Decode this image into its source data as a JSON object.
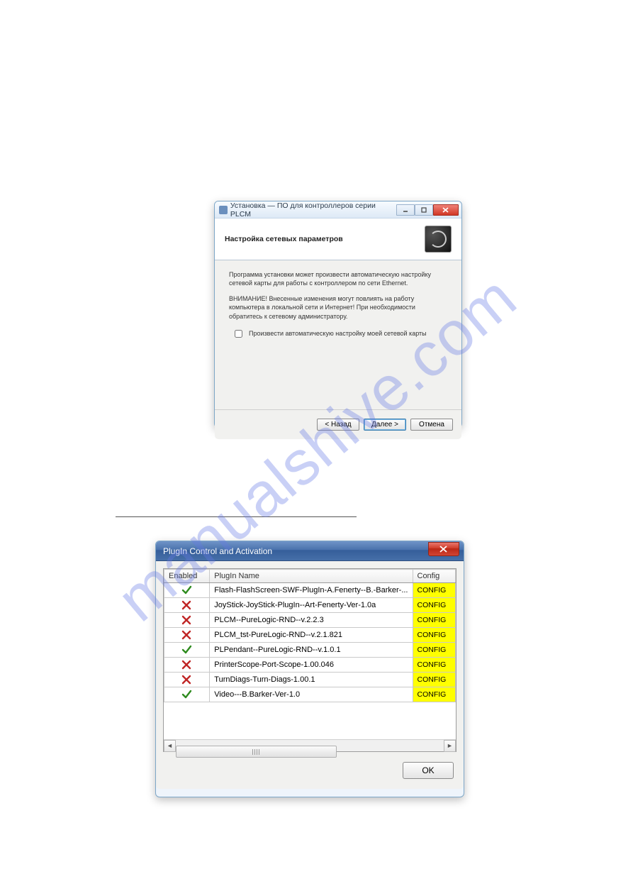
{
  "watermark": "manualshive.com",
  "installer": {
    "window_title": "Установка — ПО для контроллеров серии PLCM",
    "header_title": "Настройка сетевых параметров",
    "paragraph1": "Программа установки может произвести автоматическую настройку сетевой карты для работы с контроллером по сети Ethernet.",
    "paragraph2": "ВНИМАНИЕ! Внесенные изменения могут повлиять на работу компьютера в локальной сети и Интернет! При необходимости обратитесь к сетевому администратору.",
    "checkbox_label": "Произвести автоматическую настройку моей сетевой карты",
    "checkbox_checked": false,
    "buttons": {
      "back": "< Назад",
      "next": "Далее >",
      "cancel": "Отмена"
    }
  },
  "plugin": {
    "window_title": "PlugIn Control and Activation",
    "columns": {
      "enabled": "Enabled",
      "name": "PlugIn Name",
      "config": "Config"
    },
    "config_label": "CONFIG",
    "ok_label": "OK",
    "rows": [
      {
        "enabled": true,
        "name": "Flash-FlashScreen-SWF-PlugIn-A.Fenerty--B.-Barker-..."
      },
      {
        "enabled": false,
        "name": "JoyStick-JoyStick-PlugIn--Art-Fenerty-Ver-1.0a"
      },
      {
        "enabled": false,
        "name": "PLCM--PureLogic-RND--v.2.2.3"
      },
      {
        "enabled": false,
        "name": "PLCM_tst-PureLogic-RND--v.2.1.821"
      },
      {
        "enabled": true,
        "name": "PLPendant--PureLogic-RND--v.1.0.1"
      },
      {
        "enabled": false,
        "name": "PrinterScope-Port-Scope-1.00.046"
      },
      {
        "enabled": false,
        "name": "TurnDiags-Turn-Diags-1.00.1"
      },
      {
        "enabled": true,
        "name": "Video---B.Barker-Ver-1.0"
      }
    ]
  }
}
